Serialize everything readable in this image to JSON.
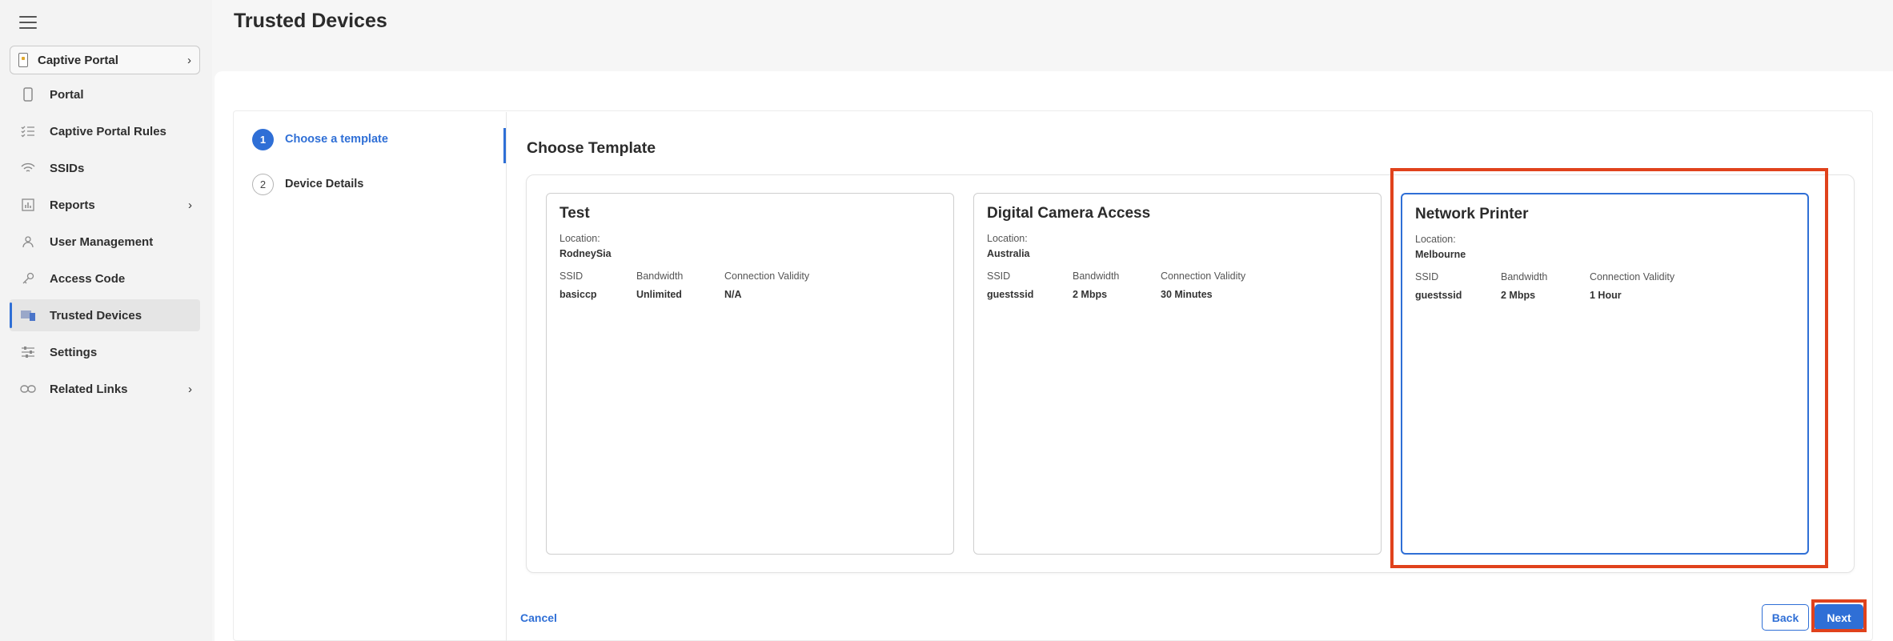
{
  "page": {
    "title": "Trusted Devices"
  },
  "sidebar": {
    "app_switcher": "Captive Portal",
    "items": [
      {
        "label": "Portal",
        "icon": "phone-icon",
        "has_chevron": false,
        "active": false
      },
      {
        "label": "Captive Portal Rules",
        "icon": "rules-list-icon",
        "has_chevron": false,
        "active": false
      },
      {
        "label": "SSIDs",
        "icon": "wifi-icon",
        "has_chevron": false,
        "active": false
      },
      {
        "label": "Reports",
        "icon": "bar-chart-icon",
        "has_chevron": true,
        "active": false
      },
      {
        "label": "User Management",
        "icon": "user-icon",
        "has_chevron": false,
        "active": false
      },
      {
        "label": "Access Code",
        "icon": "key-icon",
        "has_chevron": false,
        "active": false
      },
      {
        "label": "Trusted Devices",
        "icon": "devices-icon",
        "has_chevron": false,
        "active": true
      },
      {
        "label": "Settings",
        "icon": "sliders-icon",
        "has_chevron": false,
        "active": false
      },
      {
        "label": "Related Links",
        "icon": "link-icon",
        "has_chevron": true,
        "active": false
      }
    ]
  },
  "wizard": {
    "steps": [
      {
        "number": "1",
        "label": "Choose a template",
        "active": true
      },
      {
        "number": "2",
        "label": "Device Details",
        "active": false
      }
    ],
    "section_title": "Choose Template",
    "templates": [
      {
        "name": "Test",
        "location_label": "Location:",
        "location": "RodneySia",
        "ssid_label": "SSID",
        "ssid": "basiccp",
        "bandwidth_label": "Bandwidth",
        "bandwidth": "Unlimited",
        "validity_label": "Connection Validity",
        "validity": "N/A",
        "selected": false
      },
      {
        "name": "Digital Camera Access",
        "location_label": "Location:",
        "location": "Australia",
        "ssid_label": "SSID",
        "ssid": "guestssid",
        "bandwidth_label": "Bandwidth",
        "bandwidth": "2 Mbps",
        "validity_label": "Connection Validity",
        "validity": "30 Minutes",
        "selected": false
      },
      {
        "name": "Network Printer",
        "location_label": "Location:",
        "location": "Melbourne",
        "ssid_label": "SSID",
        "ssid": "guestssid",
        "bandwidth_label": "Bandwidth",
        "bandwidth": "2 Mbps",
        "validity_label": "Connection Validity",
        "validity": "1 Hour",
        "selected": true
      }
    ],
    "footer": {
      "cancel": "Cancel",
      "back": "Back",
      "next": "Next"
    }
  },
  "colors": {
    "accent": "#2f6fd6",
    "highlight": "#e0421c"
  }
}
